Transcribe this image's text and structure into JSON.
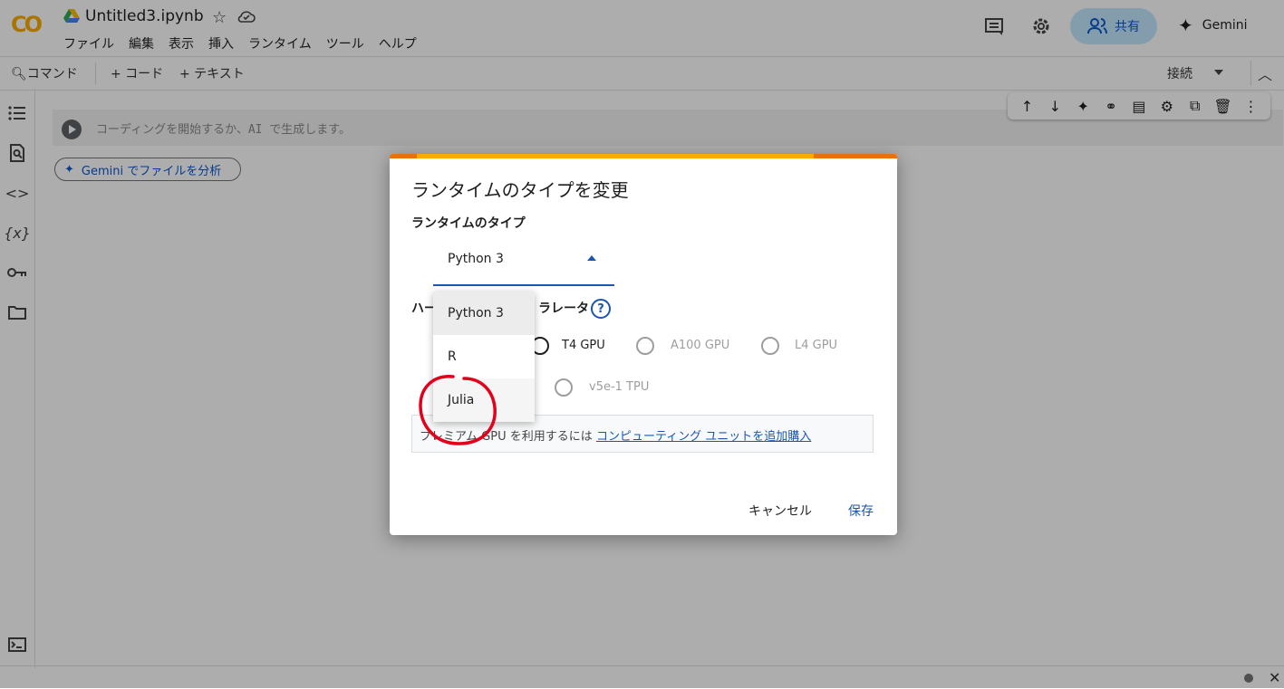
{
  "header": {
    "title": "Untitled3.ipynb",
    "menu": [
      "ファイル",
      "編集",
      "表示",
      "挿入",
      "ランタイム",
      "ツール",
      "ヘルプ"
    ],
    "share_label": "共有",
    "gemini_label": "Gemini"
  },
  "toolbar": {
    "command_label": "コマンド",
    "code_label": "+ コード",
    "text_label": "+ テキスト",
    "connect_label": "接続"
  },
  "cell": {
    "placeholder": "コーディングを開始するか、AI で生成します。",
    "gemini_chip": "Gemini でファイルを分析"
  },
  "dialog": {
    "title": "ランタイムのタイプを変更",
    "runtime_type_label": "ランタイムのタイプ",
    "runtime_selected": "Python 3",
    "runtime_options": [
      "Python 3",
      "R",
      "Julia"
    ],
    "hw_label_left": "ハー",
    "hw_label_right": "ラレータ",
    "help_glyph": "?",
    "accelerators": [
      {
        "label": "T4 GPU",
        "enabled": true
      },
      {
        "label": "A100 GPU",
        "enabled": false
      },
      {
        "label": "L4 GPU",
        "enabled": false
      },
      {
        "label": "v5e-1 TPU",
        "enabled": false
      }
    ],
    "info_text": "プレミアム GPU を利用するには",
    "info_link": "コンピューティング ユニットを追加購入",
    "cancel_label": "キャンセル",
    "save_label": "保存"
  },
  "colors": {
    "accent": "#1a56b0",
    "orange": "#e8710a",
    "yellow": "#f9ab00",
    "annotation": "#e3001b"
  }
}
